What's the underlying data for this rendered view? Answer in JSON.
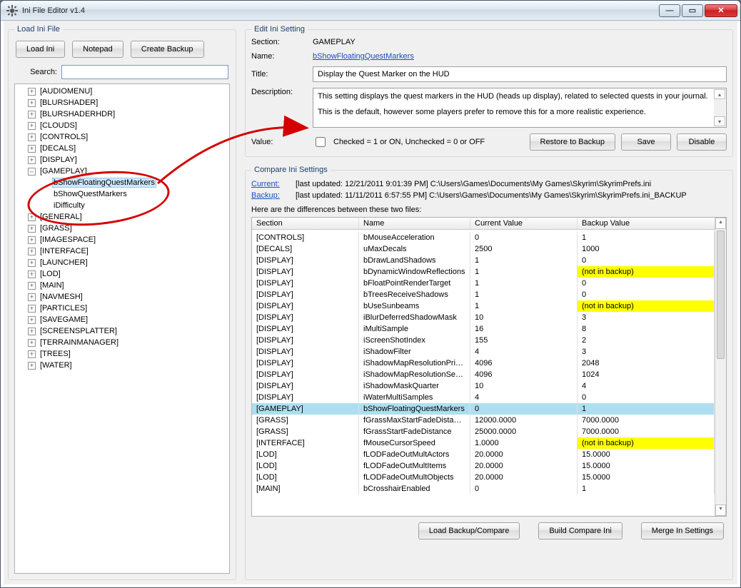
{
  "window": {
    "title": "Ini File Editor v1.4"
  },
  "left": {
    "legend": "Load Ini File",
    "buttons": {
      "load": "Load Ini",
      "notepad": "Notepad",
      "backup": "Create Backup"
    },
    "search_label": "Search:",
    "tree": [
      {
        "label": "[AUDIOMENU]",
        "exp": "+"
      },
      {
        "label": "[BLURSHADER]",
        "exp": "+"
      },
      {
        "label": "[BLURSHADERHDR]",
        "exp": "+"
      },
      {
        "label": "[CLOUDS]",
        "exp": "+"
      },
      {
        "label": "[CONTROLS]",
        "exp": "+"
      },
      {
        "label": "[DECALS]",
        "exp": "+"
      },
      {
        "label": "[DISPLAY]",
        "exp": "+"
      },
      {
        "label": "[GAMEPLAY]",
        "exp": "–",
        "children": [
          {
            "label": "bShowFloatingQuestMarkers",
            "selected": true
          },
          {
            "label": "bShowQuestMarkers"
          },
          {
            "label": "iDifficulty"
          }
        ]
      },
      {
        "label": "[GENERAL]",
        "exp": "+"
      },
      {
        "label": "[GRASS]",
        "exp": "+"
      },
      {
        "label": "[IMAGESPACE]",
        "exp": "+"
      },
      {
        "label": "[INTERFACE]",
        "exp": "+"
      },
      {
        "label": "[LAUNCHER]",
        "exp": "+"
      },
      {
        "label": "[LOD]",
        "exp": "+"
      },
      {
        "label": "[MAIN]",
        "exp": "+"
      },
      {
        "label": "[NAVMESH]",
        "exp": "+"
      },
      {
        "label": "[PARTICLES]",
        "exp": "+"
      },
      {
        "label": "[SAVEGAME]",
        "exp": "+"
      },
      {
        "label": "[SCREENSPLATTER]",
        "exp": "+"
      },
      {
        "label": "[TERRAINMANAGER]",
        "exp": "+"
      },
      {
        "label": "[TREES]",
        "exp": "+"
      },
      {
        "label": "[WATER]",
        "exp": "+"
      }
    ]
  },
  "edit": {
    "legend": "Edit Ini Setting",
    "section_label": "Section:",
    "section_value": "GAMEPLAY",
    "name_label": "Name:",
    "name_value": "bShowFloatingQuestMarkers",
    "title_label": "Title:",
    "title_value": "Display the Quest Marker on the HUD",
    "desc_label": "Description:",
    "desc_line1": "This setting displays the quest markers in the HUD (heads up display), related to selected quests in your journal.",
    "desc_line2": "This is the default, however some players prefer to remove this for a more realistic experience.",
    "value_label": "Value:",
    "value_check_text": "Checked = 1 or ON, Unchecked = 0 or OFF",
    "restore": "Restore to Backup",
    "save": "Save",
    "disable": "Disable"
  },
  "compare": {
    "legend": "Compare Ini Settings",
    "current_label": "Current:",
    "current_meta": "[last updated: 12/21/2011 9:01:39 PM]     C:\\Users\\Games\\Documents\\My Games\\Skyrim\\SkyrimPrefs.ini",
    "backup_label": "Backup:",
    "backup_meta": "[last updated: 11/11/2011 6:57:55 PM]     C:\\Users\\Games\\Documents\\My Games\\Skyrim\\SkyrimPrefs.ini_BACKUP",
    "diff_label": "Here are the differences between these two files:",
    "cols": {
      "section": "Section",
      "name": "Name",
      "current": "Current Value",
      "backup": "Backup Value"
    },
    "rows": [
      {
        "sec": "[CONTROLS]",
        "name": "bMouseAcceleration",
        "cur": "0",
        "bak": "1"
      },
      {
        "sec": "[DECALS]",
        "name": "uMaxDecals",
        "cur": "2500",
        "bak": "1000"
      },
      {
        "sec": "[DISPLAY]",
        "name": "bDrawLandShadows",
        "cur": "1",
        "bak": "0"
      },
      {
        "sec": "[DISPLAY]",
        "name": "bDynamicWindowReflections",
        "cur": "1",
        "bak": "(not in backup)",
        "hl": "yellow"
      },
      {
        "sec": "[DISPLAY]",
        "name": "bFloatPointRenderTarget",
        "cur": "1",
        "bak": "0"
      },
      {
        "sec": "[DISPLAY]",
        "name": "bTreesReceiveShadows",
        "cur": "1",
        "bak": "0"
      },
      {
        "sec": "[DISPLAY]",
        "name": "bUseSunbeams",
        "cur": "1",
        "bak": "(not in backup)",
        "hl": "yellow"
      },
      {
        "sec": "[DISPLAY]",
        "name": "iBlurDeferredShadowMask",
        "cur": "10",
        "bak": "3"
      },
      {
        "sec": "[DISPLAY]",
        "name": "iMultiSample",
        "cur": "16",
        "bak": "8"
      },
      {
        "sec": "[DISPLAY]",
        "name": "iScreenShotIndex",
        "cur": "155",
        "bak": "2"
      },
      {
        "sec": "[DISPLAY]",
        "name": "iShadowFilter",
        "cur": "4",
        "bak": "3"
      },
      {
        "sec": "[DISPLAY]",
        "name": "iShadowMapResolutionPrim...",
        "cur": "4096",
        "bak": "2048"
      },
      {
        "sec": "[DISPLAY]",
        "name": "iShadowMapResolutionSec...",
        "cur": "4096",
        "bak": "1024"
      },
      {
        "sec": "[DISPLAY]",
        "name": "iShadowMaskQuarter",
        "cur": "10",
        "bak": "4"
      },
      {
        "sec": "[DISPLAY]",
        "name": "iWaterMultiSamples",
        "cur": "4",
        "bak": "0"
      },
      {
        "sec": "[GAMEPLAY]",
        "name": "bShowFloatingQuestMarkers",
        "cur": "0",
        "bak": "1",
        "hl": "blue"
      },
      {
        "sec": "[GRASS]",
        "name": "fGrassMaxStartFadeDistance",
        "cur": "12000.0000",
        "bak": "7000.0000"
      },
      {
        "sec": "[GRASS]",
        "name": "fGrassStartFadeDistance",
        "cur": "25000.0000",
        "bak": "7000.0000"
      },
      {
        "sec": "[INTERFACE]",
        "name": "fMouseCursorSpeed",
        "cur": "1.0000",
        "bak": "(not in backup)",
        "hl": "yellow"
      },
      {
        "sec": "[LOD]",
        "name": "fLODFadeOutMultActors",
        "cur": "20.0000",
        "bak": "15.0000"
      },
      {
        "sec": "[LOD]",
        "name": "fLODFadeOutMultItems",
        "cur": "20.0000",
        "bak": "15.0000"
      },
      {
        "sec": "[LOD]",
        "name": "fLODFadeOutMultObjects",
        "cur": "20.0000",
        "bak": "15.0000"
      },
      {
        "sec": "[MAIN]",
        "name": "bCrosshairEnabled",
        "cur": "0",
        "bak": "1"
      }
    ],
    "btns": {
      "load": "Load Backup/Compare",
      "build": "Build Compare Ini",
      "merge": "Merge In Settings"
    }
  }
}
